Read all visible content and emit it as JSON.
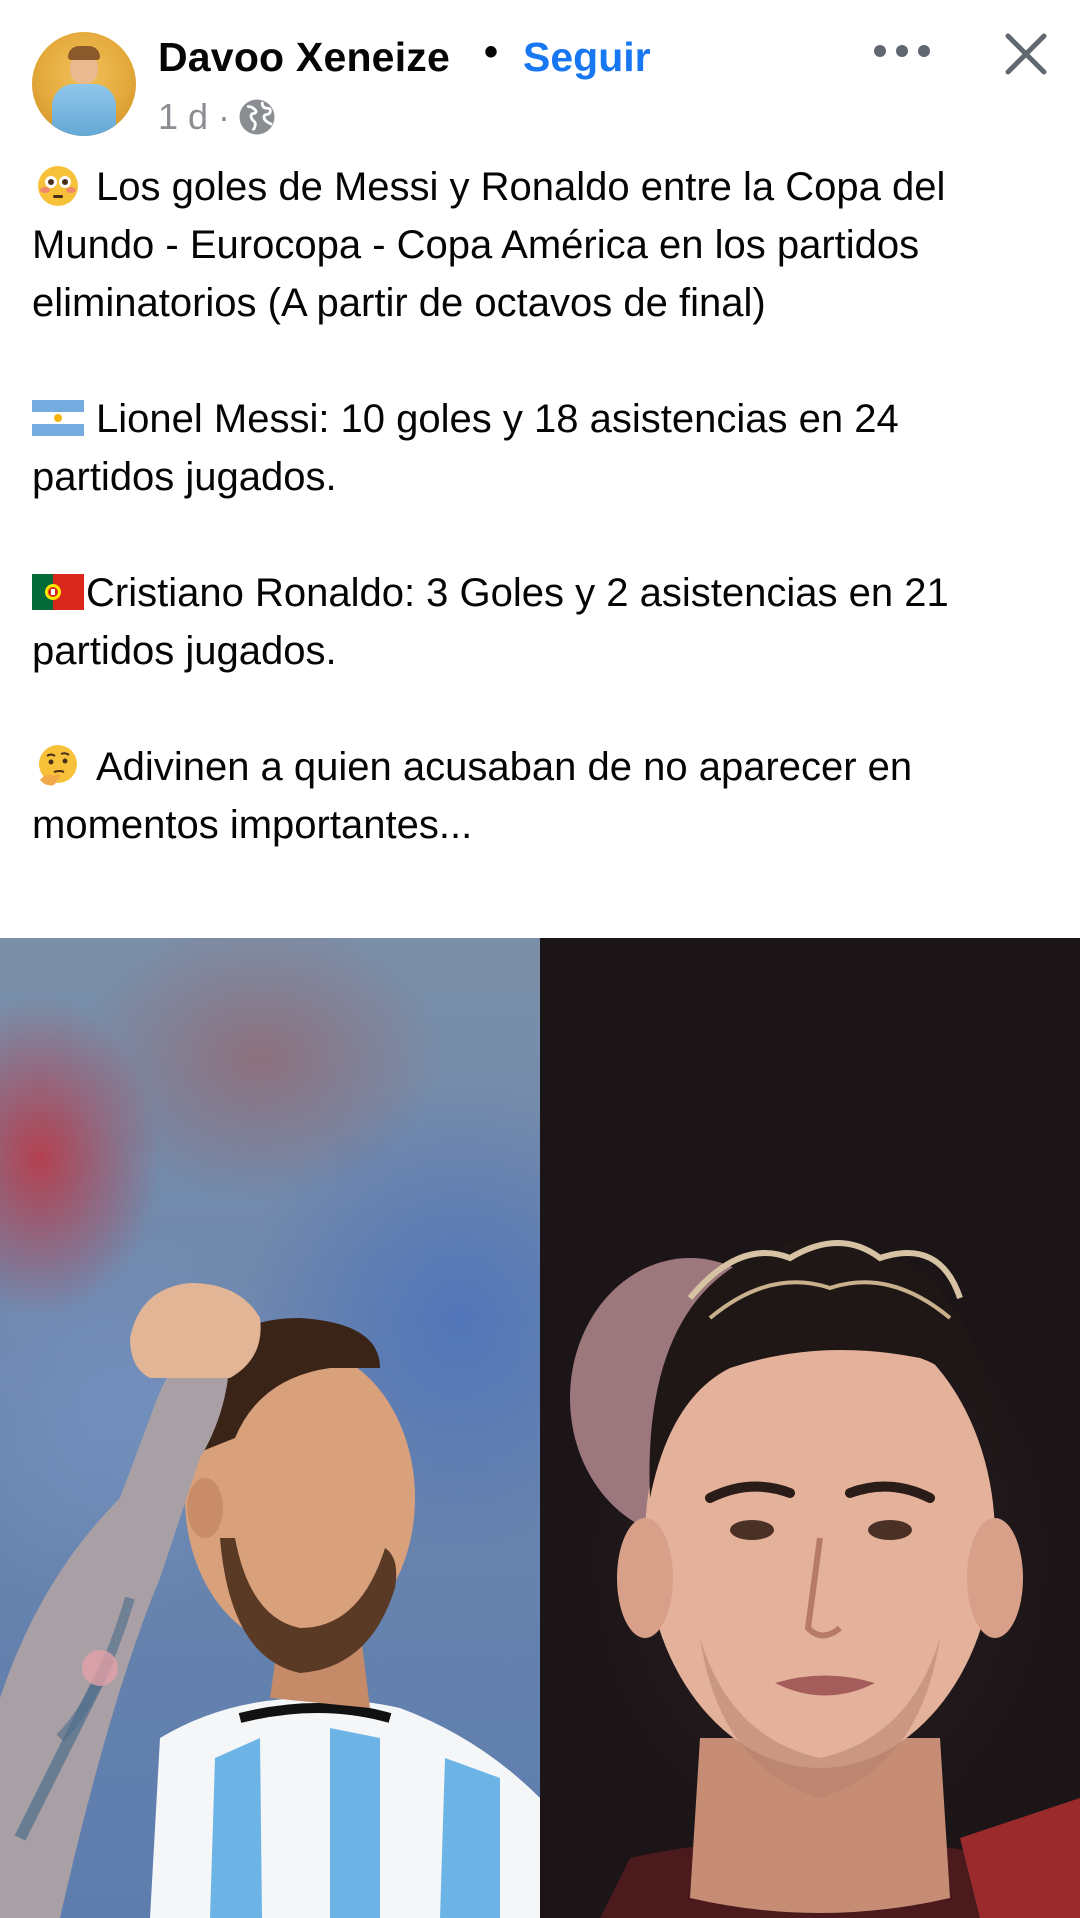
{
  "post": {
    "author": "Davoo Xeneize",
    "separator": "•",
    "follow_label": "Seguir",
    "time": "1 d ·",
    "privacy_icon": "globe-icon",
    "more_icon": "more-horizontal-icon",
    "close_icon": "close-icon",
    "text": {
      "line1": "Los goles de Messi y Ronaldo entre la Copa del Mundo - Eurocopa - Copa América en los partidos eliminatorios (A partir de octavos de final)",
      "line2": "Lionel Messi: 10 goles y 18 asistencias en 24 partidos jugados.",
      "line3": "Cristiano Ronaldo: 3 Goles y 2 asistencias en 21 partidos jugados.",
      "line4": "Adivinen a quien acusaban de no aparecer en momentos importantes..."
    },
    "emojis": [
      "flushed-face-emoji",
      "argentina-flag-emoji",
      "portugal-flag-emoji",
      "thinking-face-emoji"
    ],
    "image": {
      "left_subject": "messi-photo",
      "right_subject": "ronaldo-photo"
    }
  },
  "colors": {
    "accent": "#1877f2",
    "text": "#050505",
    "secondary_text": "#8a8d91",
    "icon": "#606770"
  }
}
